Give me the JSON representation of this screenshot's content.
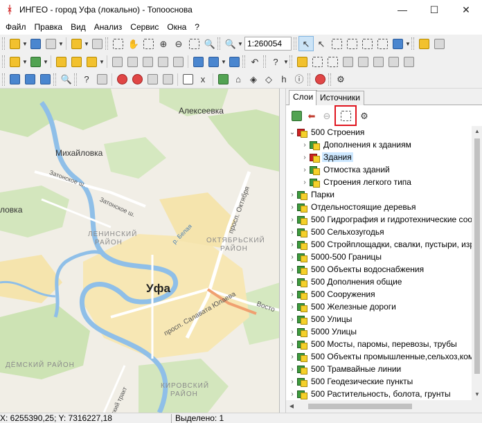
{
  "window": {
    "title": "ИНГЕО - город Уфа (локально) - Топооснова",
    "controls": {
      "minimize": "—",
      "maximize": "☐",
      "close": "✕"
    }
  },
  "menu": [
    "Файл",
    "Правка",
    "Вид",
    "Анализ",
    "Сервис",
    "Окна",
    "?"
  ],
  "toolbar": {
    "scale": "1:260054"
  },
  "map": {
    "labels": {
      "alekseevka": "Алексеевка",
      "mikhaylovka": "Михайловка",
      "zatonskoe1": "Затонское ш.",
      "zatonskoe2": "Затонское ш.",
      "lovka": "ловка",
      "leninsky": "ЛЕНИНСКИЙ",
      "leninsky2": "РАЙОН",
      "belaya": "р. Белая",
      "oktyabrya": "просп. Октября",
      "oktyabrsky": "ОКТЯБРЬСКИЙ",
      "oktyabrsky2": "РАЙОН",
      "ufa": "Уфа",
      "salavata": "просп. Салавата Юлаева",
      "vosto": "Восто",
      "demsky": "ДЁМСКИЙ РАЙОН",
      "kirovsky": "КИРОВСКИЙ",
      "kirovsky2": "РАЙОН",
      "trakt": "ский тракт"
    }
  },
  "panel": {
    "tabs": [
      "Слои",
      "Источники"
    ],
    "tree": [
      {
        "label": "500 Строения",
        "expanded": true,
        "level": 0
      },
      {
        "label": "Дополнения к зданиям",
        "level": 1
      },
      {
        "label": "Здания",
        "level": 1,
        "selected": true,
        "icon": "red"
      },
      {
        "label": "Отмостка зданий",
        "level": 1
      },
      {
        "label": "Строения легкого типа",
        "level": 1
      },
      {
        "label": "Парки",
        "level": 0
      },
      {
        "label": "Отдельностоящие деревья",
        "level": 0
      },
      {
        "label": "500 Гидрография и гидротехнические соо",
        "level": 0
      },
      {
        "label": "500 Сельхозугодья",
        "level": 0
      },
      {
        "label": "500 Стройплощадки, свалки, пустыри, изр",
        "level": 0
      },
      {
        "label": "5000-500 Границы",
        "level": 0
      },
      {
        "label": "500 Объекты водоснабжения",
        "level": 0
      },
      {
        "label": "500 Дополнения общие",
        "level": 0
      },
      {
        "label": "500 Сооружения",
        "level": 0
      },
      {
        "label": "500 Железные дороги",
        "level": 0
      },
      {
        "label": "500 Улицы",
        "level": 0
      },
      {
        "label": "5000 Улицы",
        "level": 0
      },
      {
        "label": "500 Мосты, паромы, перевозы, трубы",
        "level": 0
      },
      {
        "label": "500 Объекты промышленные,сельхоз,ком",
        "level": 0
      },
      {
        "label": "500 Трамвайные линии",
        "level": 0
      },
      {
        "label": "500 Геодезические пункты",
        "level": 0
      },
      {
        "label": "500 Растительность, болота, грунты",
        "level": 0
      }
    ]
  },
  "status": {
    "coords": "X: 6255390,25; Y: 7316227,18",
    "selected": "Выделено: 1"
  }
}
